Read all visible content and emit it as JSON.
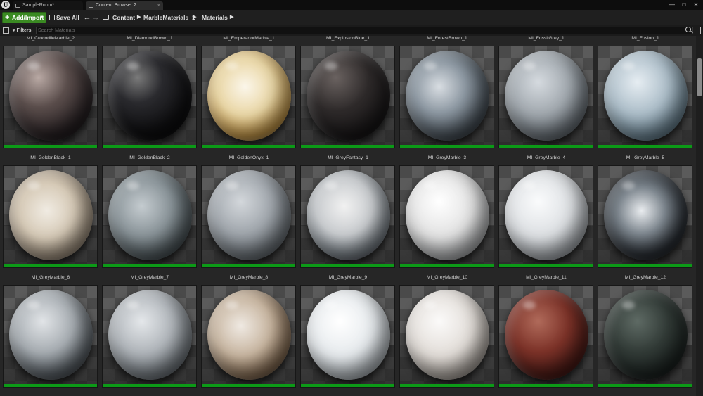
{
  "window": {
    "tabs": [
      {
        "label": "SampleRoom*"
      },
      {
        "label": "Content Browser 2"
      }
    ],
    "controls": {
      "minimize": "—",
      "maximize": "□",
      "close": "✕"
    }
  },
  "toolbar": {
    "add_import_label": "Add/Import",
    "save_all_label": "Save All",
    "back_icon": "arrow-left-icon",
    "forward_icon": "arrow-right-icon",
    "path": [
      "Content",
      "MarbleMaterials_1",
      "Materials"
    ]
  },
  "filterbar": {
    "filters_label": "Filters",
    "search_placeholder": "Search Materials",
    "search_value": ""
  },
  "colors": {
    "add_button": "#3a8a22",
    "asset_bar": "#0c9a17",
    "panel_bg": "#262626"
  },
  "rows": [
    {
      "items": [
        {
          "name": "MI_CrocodileMarble_2",
          "ball": "radial-gradient(circle at 35% 30%,#b9a9a4 0%,#5b4e4c 35%,#2a2325 70%,#121012 100%)"
        },
        {
          "name": "MI_DiamondBrown_1",
          "ball": "radial-gradient(circle at 35% 30%,#7a7a7a 0%,#2a2a2e 30%,#101012 65%,#050506 100%)"
        },
        {
          "name": "MI_EmperadorMarble_1",
          "ball": "radial-gradient(circle at 45% 40%,#fbf6ea 0%,#ead7a6 40%,#c99b4a 70%,#8e7550 100%)"
        },
        {
          "name": "MI_ExplosionBlue_1",
          "ball": "radial-gradient(circle at 35% 30%,#6a6260 0%,#2e2a2a 40%,#181617 75%,#0c0b0b 100%)"
        },
        {
          "name": "MI_ForestBrown_1",
          "ball": "radial-gradient(circle at 40% 40%,#d8dde2 0%,#8e99a3 35%,#4a535b 70%,#23282d 100%)"
        },
        {
          "name": "MI_FossilGrey_1",
          "ball": "radial-gradient(circle at 40% 35%,#d5dadf 0%,#a3aab0 40%,#6b737a 75%,#3b4045 100%)"
        },
        {
          "name": "MI_Fusion_1",
          "ball": "radial-gradient(circle at 40% 35%,#e6edf2 0%,#aebfca 40%,#6b8594 75%,#3a4a55 100%)"
        }
      ]
    },
    {
      "items": [
        {
          "name": "MI_GoldenBlack_1",
          "ball": "radial-gradient(circle at 45% 45%,#f0ebe2 0%,#d7cbb8 40%,#a69784 70%,#5e5548 100%)"
        },
        {
          "name": "MI_GoldenBlack_2",
          "ball": "radial-gradient(circle at 40% 40%,#c4cbcf 0%,#8a9499 40%,#4b5559 75%,#23292c 100%)"
        },
        {
          "name": "MI_GoldenOnyx_1",
          "ball": "radial-gradient(circle at 40% 35%,#d3d7db 0%,#a2a8ae 40%,#6c7379 75%,#3b4045 100%)"
        },
        {
          "name": "MI_GreyFantasy_1",
          "ball": "radial-gradient(circle at 45% 40%,#f1f1f1 0%,#c9cccf 40%,#7d858c 70%,#3a3240 100%)"
        },
        {
          "name": "MI_GreyMarble_3",
          "ball": "radial-gradient(circle at 40% 35%,#ffffff 0%,#e3e3e3 45%,#b5b7b9 75%,#7c7f82 100%)"
        },
        {
          "name": "MI_GreyMarble_4",
          "ball": "radial-gradient(circle at 40% 35%,#fafbfc 0%,#dde0e3 45%,#aeb3b8 75%,#757b80 100%)"
        },
        {
          "name": "MI_GreyMarble_5",
          "ball": "radial-gradient(circle at 45% 45%,#e9ecef 0%,#7c858d 35%,#2e3339 65%,#121417 100%)"
        }
      ]
    },
    {
      "items": [
        {
          "name": "MI_GreyMarble_6",
          "ball": "radial-gradient(circle at 40% 35%,#e1e4e7 0%,#a7adb2 40%,#5f666c 70%,#2f3337 100%)"
        },
        {
          "name": "MI_GreyMarble_7",
          "ball": "radial-gradient(circle at 40% 35%,#e4e7ea 0%,#b1b6bb 40%,#747b81 75%,#3f4448 100%)"
        },
        {
          "name": "MI_GreyMarble_8",
          "ball": "radial-gradient(circle at 40% 40%,#efe9e2 0%,#c8b6a1 40%,#8c7258 70%,#4a3b2e 100%)"
        },
        {
          "name": "MI_GreyMarble_9",
          "ball": "radial-gradient(circle at 40% 35%,#ffffff 0%,#e6eaed 45%,#b8bfc4 75%,#7d858b 100%)"
        },
        {
          "name": "MI_GreyMarble_10",
          "ball": "radial-gradient(circle at 40% 35%,#fbfaf9 0%,#e2ddd8 45%,#b3aca5 75%,#77706a 100%)"
        },
        {
          "name": "MI_GreyMarble_11",
          "ball": "radial-gradient(circle at 40% 35%,#b06a5a 0%,#7c3228 40%,#4a1a16 75%,#260d0b 100%)"
        },
        {
          "name": "MI_GreyMarble_12",
          "ball": "radial-gradient(circle at 40% 35%,#5e6a64 0%,#323b37 40%,#1b2220 75%,#0b0e0d 100%)"
        }
      ]
    }
  ]
}
